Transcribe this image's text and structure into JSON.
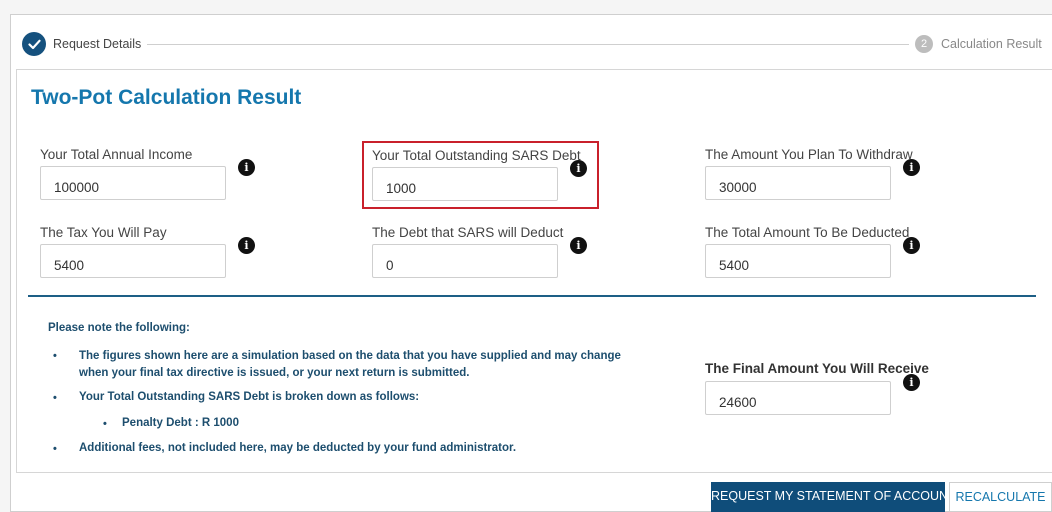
{
  "stepper": {
    "step1_label": "Request Details",
    "step2_number": "2",
    "step2_label": "Calculation Result"
  },
  "title": "Two-Pot Calculation Result",
  "fields": {
    "annual_income": {
      "label": "Your Total Annual Income",
      "value": "100000"
    },
    "sars_debt": {
      "label": "Your Total Outstanding SARS Debt",
      "value": "1000"
    },
    "plan_withdraw": {
      "label": "The Amount You Plan To Withdraw",
      "value": "30000"
    },
    "tax_pay": {
      "label": "The Tax You Will Pay",
      "value": "5400"
    },
    "sars_deduct": {
      "label": "The Debt that SARS will Deduct",
      "value": "0"
    },
    "total_deducted": {
      "label": "The Total Amount To Be Deducted",
      "value": "5400"
    },
    "final_amount": {
      "label": "The Final Amount You Will Receive",
      "value": "24600"
    }
  },
  "info_icon_glyph": "i",
  "notes": {
    "heading": "Please note the following:",
    "bullet": "•",
    "item1_line1": "The figures shown here are a simulation based on the data that you have supplied and may change",
    "item1_line2": "when your final tax directive is issued, or your next return is submitted.",
    "item2": "Your Total Outstanding SARS Debt is broken down as follows:",
    "sub_item": "Penalty Debt : R 1000",
    "item3": "Additional fees, not included here, may be deducted by your fund administrator."
  },
  "buttons": {
    "statement": "REQUEST MY STATEMENT OF ACCOUNT",
    "recalculate": "RECALCULATE"
  },
  "colors": {
    "accent": "#1577ad",
    "primary_button": "#0f4d7a",
    "highlight": "#c9202b"
  }
}
